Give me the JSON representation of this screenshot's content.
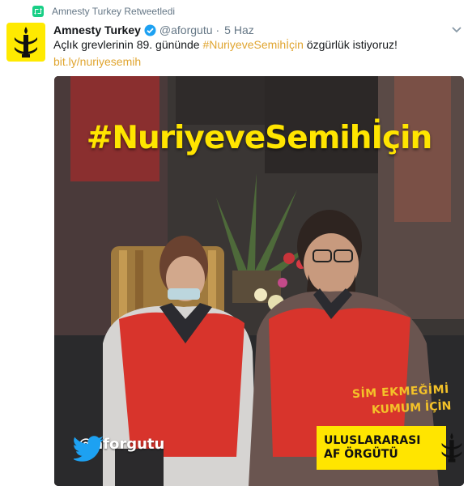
{
  "retweet": {
    "label": "Amnesty Turkey Retweetledi",
    "icon": "retweet-icon",
    "icon_color": "#19cf86"
  },
  "tweet": {
    "author_name": "Amnesty Turkey",
    "author_handle": "@aforgutu",
    "separator": "·",
    "timestamp": "5 Haz",
    "verified_color": "#1da1f2",
    "text_before": "Açlık grevlerinin 89. gününde ",
    "hashtag": "#NuriyeveSemihİçin",
    "text_after": " özgürlük istiyoruz!",
    "link": "bit.ly/nuriyesemih",
    "link_color": "#e0a530"
  },
  "media": {
    "headline": "#NuriyeveSemihİçin",
    "headline_color": "#ffe500",
    "vest_line1": "SİM EKMEĞİMİ",
    "vest_line2": "KUMUM İÇİN",
    "twitter_handle": "@aforgutu",
    "org_line1": "ULUSLARARASI",
    "org_line2": "AF ÖRGÜTÜ",
    "vest_color": "#d8342c",
    "brand_yellow": "#ffe500"
  }
}
